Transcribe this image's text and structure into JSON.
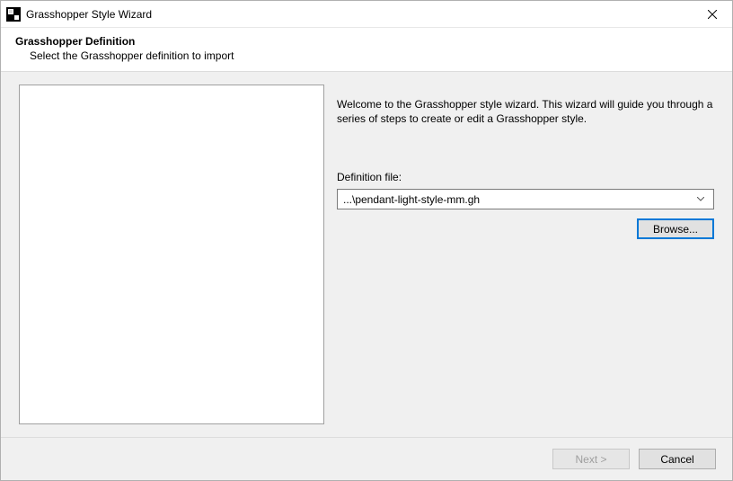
{
  "window": {
    "title": "Grasshopper Style Wizard"
  },
  "header": {
    "title": "Grasshopper Definition",
    "subtitle": "Select the Grasshopper definition to import"
  },
  "main": {
    "intro": "Welcome to the Grasshopper style wizard. This wizard will guide you through a series of steps to create or edit a Grasshopper style.",
    "definition_label": "Definition file:",
    "definition_value": "...\\pendant-light-style-mm.gh",
    "browse_label": "Browse..."
  },
  "footer": {
    "next_label": "Next >",
    "cancel_label": "Cancel"
  }
}
